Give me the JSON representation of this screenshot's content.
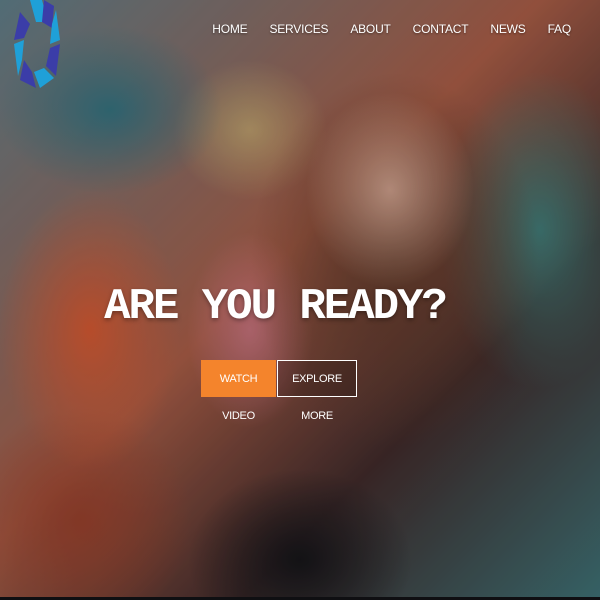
{
  "brand": {
    "logo_icon": "aperture-logo-icon",
    "colors": {
      "logo_primary": "#3b3da8",
      "logo_secondary": "#1fa0d8",
      "accent": "#f4842c"
    }
  },
  "nav": {
    "items": [
      {
        "label": "HOME"
      },
      {
        "label": "SERVICES"
      },
      {
        "label": "ABOUT"
      },
      {
        "label": "CONTACT"
      },
      {
        "label": "NEWS"
      },
      {
        "label": "FAQ"
      }
    ]
  },
  "hero": {
    "headline": "ARE YOU READY?",
    "primary_button": "WATCH VIDEO",
    "secondary_button": "EXPLORE MORE"
  }
}
